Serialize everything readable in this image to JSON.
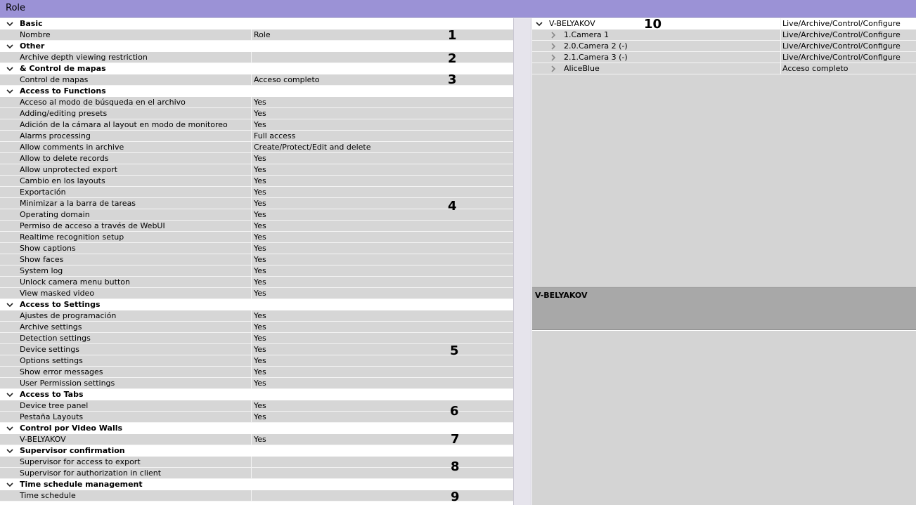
{
  "window": {
    "title": "Role"
  },
  "properties": [
    {
      "kind": "group",
      "label": "Basic"
    },
    {
      "kind": "prop",
      "label": "Nombre",
      "value": "Role"
    },
    {
      "kind": "group",
      "label": "Other"
    },
    {
      "kind": "prop",
      "label": "Archive depth viewing restriction",
      "value": ""
    },
    {
      "kind": "group",
      "label": "& Control de mapas"
    },
    {
      "kind": "prop",
      "label": "Control de mapas",
      "value": "Acceso completo"
    },
    {
      "kind": "group",
      "label": "Access to Functions"
    },
    {
      "kind": "prop",
      "label": "Acceso al modo de búsqueda en el archivo",
      "value": "Yes"
    },
    {
      "kind": "prop",
      "label": "Adding/editing presets",
      "value": "Yes"
    },
    {
      "kind": "prop",
      "label": "Adición de la cámara al layout en modo de monitoreo",
      "value": "Yes"
    },
    {
      "kind": "prop",
      "label": "Alarms processing",
      "value": "Full access"
    },
    {
      "kind": "prop",
      "label": "Allow comments in archive",
      "value": "Create/Protect/Edit and delete"
    },
    {
      "kind": "prop",
      "label": "Allow to delete records",
      "value": "Yes"
    },
    {
      "kind": "prop",
      "label": "Allow unprotected export",
      "value": "Yes"
    },
    {
      "kind": "prop",
      "label": "Cambio en los layouts",
      "value": "Yes"
    },
    {
      "kind": "prop",
      "label": "Exportación",
      "value": "Yes"
    },
    {
      "kind": "prop",
      "label": "Minimizar a la barra de tareas",
      "value": "Yes"
    },
    {
      "kind": "prop",
      "label": "Operating domain",
      "value": "Yes"
    },
    {
      "kind": "prop",
      "label": "Permiso de acceso a través de WebUI",
      "value": "Yes"
    },
    {
      "kind": "prop",
      "label": "Realtime recognition setup",
      "value": "Yes"
    },
    {
      "kind": "prop",
      "label": "Show captions",
      "value": "Yes"
    },
    {
      "kind": "prop",
      "label": "Show faces",
      "value": "Yes"
    },
    {
      "kind": "prop",
      "label": "System log",
      "value": "Yes"
    },
    {
      "kind": "prop",
      "label": "Unlock camera menu button",
      "value": "Yes"
    },
    {
      "kind": "prop",
      "label": "View masked video",
      "value": "Yes"
    },
    {
      "kind": "group",
      "label": "Access to Settings"
    },
    {
      "kind": "prop",
      "label": "Ajustes de programación",
      "value": "Yes"
    },
    {
      "kind": "prop",
      "label": "Archive settings",
      "value": "Yes"
    },
    {
      "kind": "prop",
      "label": "Detection settings",
      "value": "Yes"
    },
    {
      "kind": "prop",
      "label": "Device settings",
      "value": "Yes"
    },
    {
      "kind": "prop",
      "label": "Options settings",
      "value": "Yes"
    },
    {
      "kind": "prop",
      "label": "Show error messages",
      "value": "Yes"
    },
    {
      "kind": "prop",
      "label": "User Permission settings",
      "value": "Yes"
    },
    {
      "kind": "group",
      "label": "Access to Tabs"
    },
    {
      "kind": "prop",
      "label": "Device tree panel",
      "value": "Yes"
    },
    {
      "kind": "prop",
      "label": "Pestaña Layouts",
      "value": "Yes"
    },
    {
      "kind": "group",
      "label": "Control por Video Walls"
    },
    {
      "kind": "prop",
      "label": "V-BELYAKOV",
      "value": "Yes"
    },
    {
      "kind": "group",
      "label": "Supervisor confirmation"
    },
    {
      "kind": "prop",
      "label": "Supervisor for access to export",
      "value": ""
    },
    {
      "kind": "prop",
      "label": "Supervisor for authorization in client",
      "value": ""
    },
    {
      "kind": "group",
      "label": "Time schedule management"
    },
    {
      "kind": "prop",
      "label": "Time schedule",
      "value": ""
    }
  ],
  "callouts": [
    {
      "text": "1"
    },
    {
      "text": "2"
    },
    {
      "text": "3"
    },
    {
      "text": "4"
    },
    {
      "text": "5"
    },
    {
      "text": "6"
    },
    {
      "text": "7"
    },
    {
      "text": "8"
    },
    {
      "text": "9"
    },
    {
      "text": "10"
    }
  ],
  "device_tree": [
    {
      "label": "V-BELYAKOV",
      "value": "Live/Archive/Control/Configure",
      "level": 0,
      "chevron": "down"
    },
    {
      "label": "1.Camera 1",
      "value": "Live/Archive/Control/Configure",
      "level": 1,
      "chevron": "right"
    },
    {
      "label": "2.0.Camera 2 (-)",
      "value": "Live/Archive/Control/Configure",
      "level": 1,
      "chevron": "right"
    },
    {
      "label": "2.1.Camera 3 (-)",
      "value": "Live/Archive/Control/Configure",
      "level": 1,
      "chevron": "right"
    },
    {
      "label": "AliceBlue",
      "value": "Acceso completo",
      "level": 1,
      "chevron": "right"
    }
  ],
  "detail_panel": {
    "title": "V-BELYAKOV"
  }
}
